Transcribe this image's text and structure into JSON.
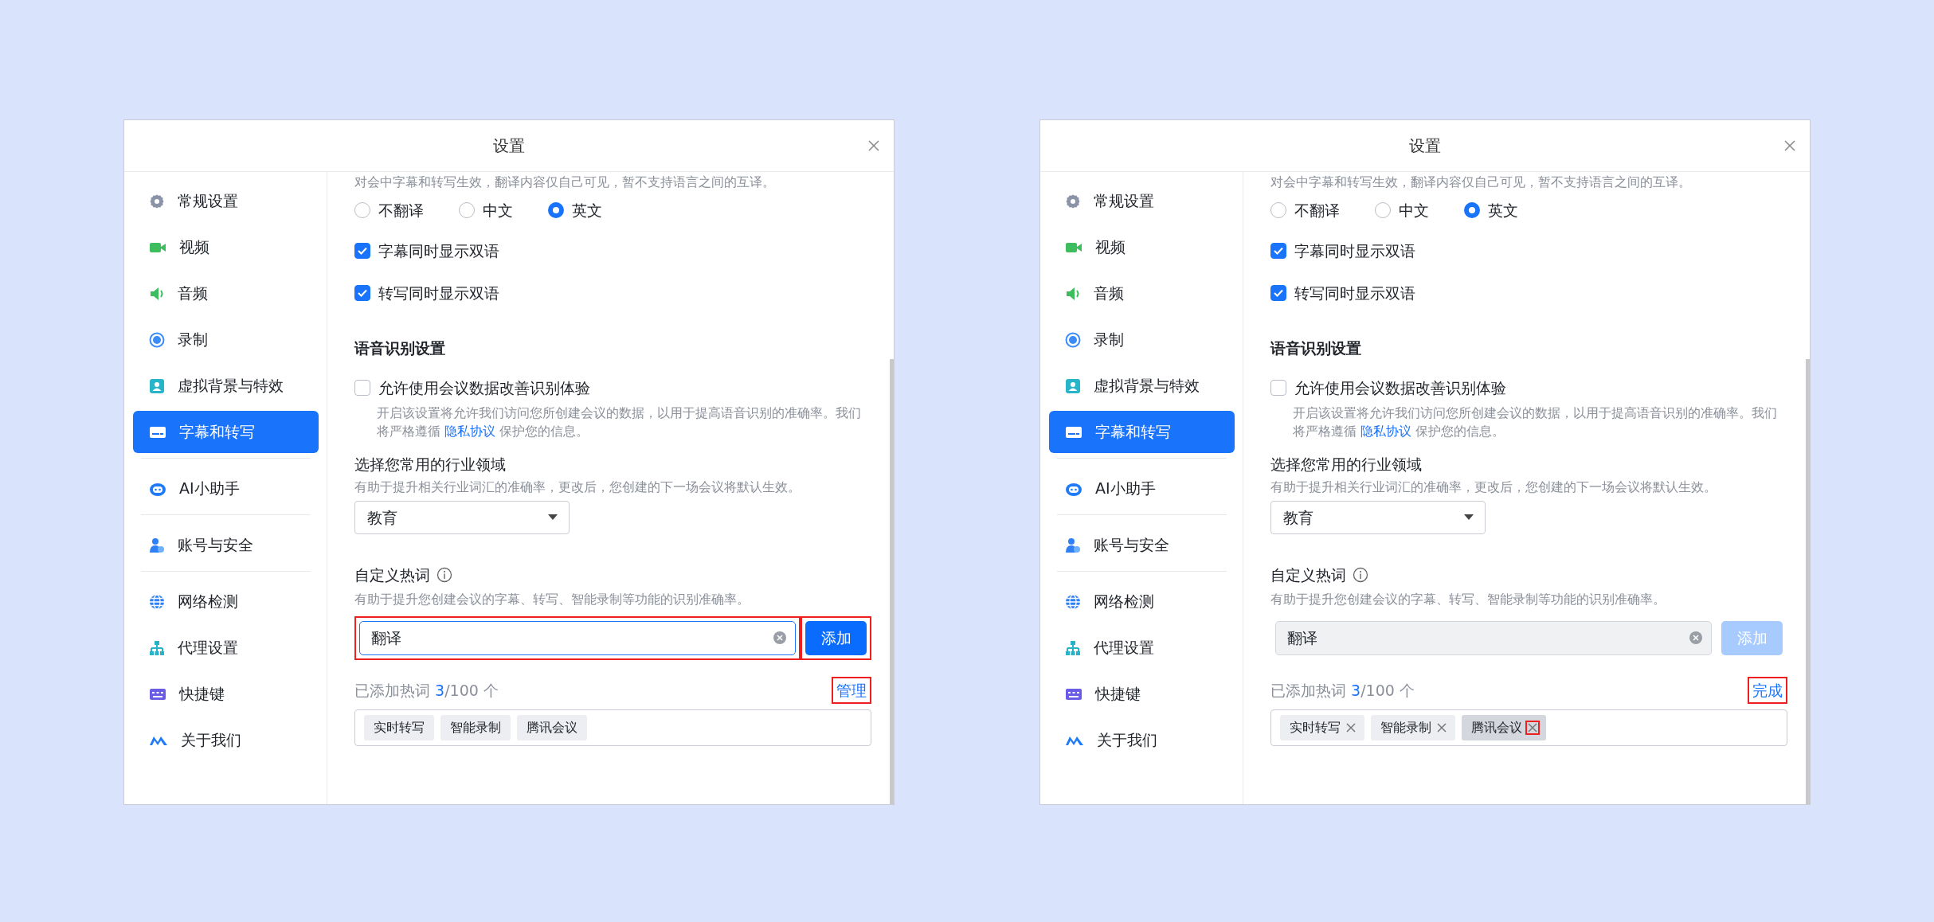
{
  "dialogs": [
    {
      "title": "设置",
      "sidebar": {
        "groups": [
          [
            {
              "label": "常规设置",
              "selected": false
            },
            {
              "label": "视频",
              "selected": false
            },
            {
              "label": "音频",
              "selected": false
            },
            {
              "label": "录制",
              "selected": false
            },
            {
              "label": "虚拟背景与特效",
              "selected": false
            },
            {
              "label": "字幕和转写",
              "selected": true
            }
          ],
          [
            {
              "label": "AI小助手",
              "selected": false
            }
          ],
          [
            {
              "label": "账号与安全",
              "selected": false
            }
          ],
          [
            {
              "label": "网络检测",
              "selected": false
            },
            {
              "label": "代理设置",
              "selected": false
            },
            {
              "label": "快捷键",
              "selected": false
            },
            {
              "label": "关于我们",
              "selected": false
            }
          ]
        ]
      },
      "clipped_note": "对会中字幕和转写生效，翻译内容仅自己可见，暂不支持语言之间的互译。",
      "translate_options": [
        {
          "label": "不翻译",
          "selected": false
        },
        {
          "label": "中文",
          "selected": false
        },
        {
          "label": "英文",
          "selected": true
        }
      ],
      "checkboxes": [
        {
          "label": "字幕同时显示双语",
          "checked": true
        },
        {
          "label": "转写同时显示双语",
          "checked": true
        }
      ],
      "section_title": "语音识别设置",
      "improve": {
        "label": "允许使用会议数据改善识别体验",
        "checked": false,
        "desc_before": "开启该设置将允许我们访问您所创建会议的数据，以用于提高语音识别的准确率。我们将严格遵循",
        "desc_link": "隐私协议",
        "desc_after": "保护您的信息。"
      },
      "industry": {
        "label": "选择您常用的行业领域",
        "hint": "有助于提升相关行业词汇的准确率，更改后，您创建的下一场会议将默认生效。",
        "value": "教育"
      },
      "hotwords": {
        "label": "自定义热词",
        "hint": "有助于提升您创建会议的字幕、转写、智能录制等功能的识别准确率。",
        "input": {
          "value": "翻译",
          "disabled": false,
          "highlighted": true
        },
        "add_button": {
          "label": "添加",
          "disabled": false,
          "highlighted": true
        },
        "added_label": "已添加热词",
        "added_count": "3",
        "added_total": "/100 个",
        "link": {
          "label": "管理",
          "highlighted": true
        },
        "tags": [
          {
            "label": "实时转写",
            "removable": false,
            "selected": false,
            "highlighted": false
          },
          {
            "label": "智能录制",
            "removable": false,
            "selected": false,
            "highlighted": false
          },
          {
            "label": "腾讯会议",
            "removable": false,
            "selected": false,
            "highlighted": false
          }
        ]
      }
    },
    {
      "title": "设置",
      "sidebar": {
        "groups": [
          [
            {
              "label": "常规设置",
              "selected": false
            },
            {
              "label": "视频",
              "selected": false
            },
            {
              "label": "音频",
              "selected": false
            },
            {
              "label": "录制",
              "selected": false
            },
            {
              "label": "虚拟背景与特效",
              "selected": false
            },
            {
              "label": "字幕和转写",
              "selected": true
            }
          ],
          [
            {
              "label": "AI小助手",
              "selected": false
            }
          ],
          [
            {
              "label": "账号与安全",
              "selected": false
            }
          ],
          [
            {
              "label": "网络检测",
              "selected": false
            },
            {
              "label": "代理设置",
              "selected": false
            },
            {
              "label": "快捷键",
              "selected": false
            },
            {
              "label": "关于我们",
              "selected": false
            }
          ]
        ]
      },
      "clipped_note": "对会中字幕和转写生效，翻译内容仅自己可见，暂不支持语言之间的互译。",
      "translate_options": [
        {
          "label": "不翻译",
          "selected": false
        },
        {
          "label": "中文",
          "selected": false
        },
        {
          "label": "英文",
          "selected": true
        }
      ],
      "checkboxes": [
        {
          "label": "字幕同时显示双语",
          "checked": true
        },
        {
          "label": "转写同时显示双语",
          "checked": true
        }
      ],
      "section_title": "语音识别设置",
      "improve": {
        "label": "允许使用会议数据改善识别体验",
        "checked": false,
        "desc_before": "开启该设置将允许我们访问您所创建会议的数据，以用于提高语音识别的准确率。我们将严格遵循",
        "desc_link": "隐私协议",
        "desc_after": "保护您的信息。"
      },
      "industry": {
        "label": "选择您常用的行业领域",
        "hint": "有助于提升相关行业词汇的准确率，更改后，您创建的下一场会议将默认生效。",
        "value": "教育"
      },
      "hotwords": {
        "label": "自定义热词",
        "hint": "有助于提升您创建会议的字幕、转写、智能录制等功能的识别准确率。",
        "input": {
          "value": "翻译",
          "disabled": true,
          "highlighted": false
        },
        "add_button": {
          "label": "添加",
          "disabled": true,
          "highlighted": false
        },
        "added_label": "已添加热词",
        "added_count": "3",
        "added_total": "/100 个",
        "link": {
          "label": "完成",
          "highlighted": true
        },
        "tags": [
          {
            "label": "实时转写",
            "removable": true,
            "selected": false,
            "highlighted": false
          },
          {
            "label": "智能录制",
            "removable": true,
            "selected": false,
            "highlighted": false
          },
          {
            "label": "腾讯会议",
            "removable": true,
            "selected": true,
            "highlighted": true
          }
        ]
      }
    }
  ]
}
